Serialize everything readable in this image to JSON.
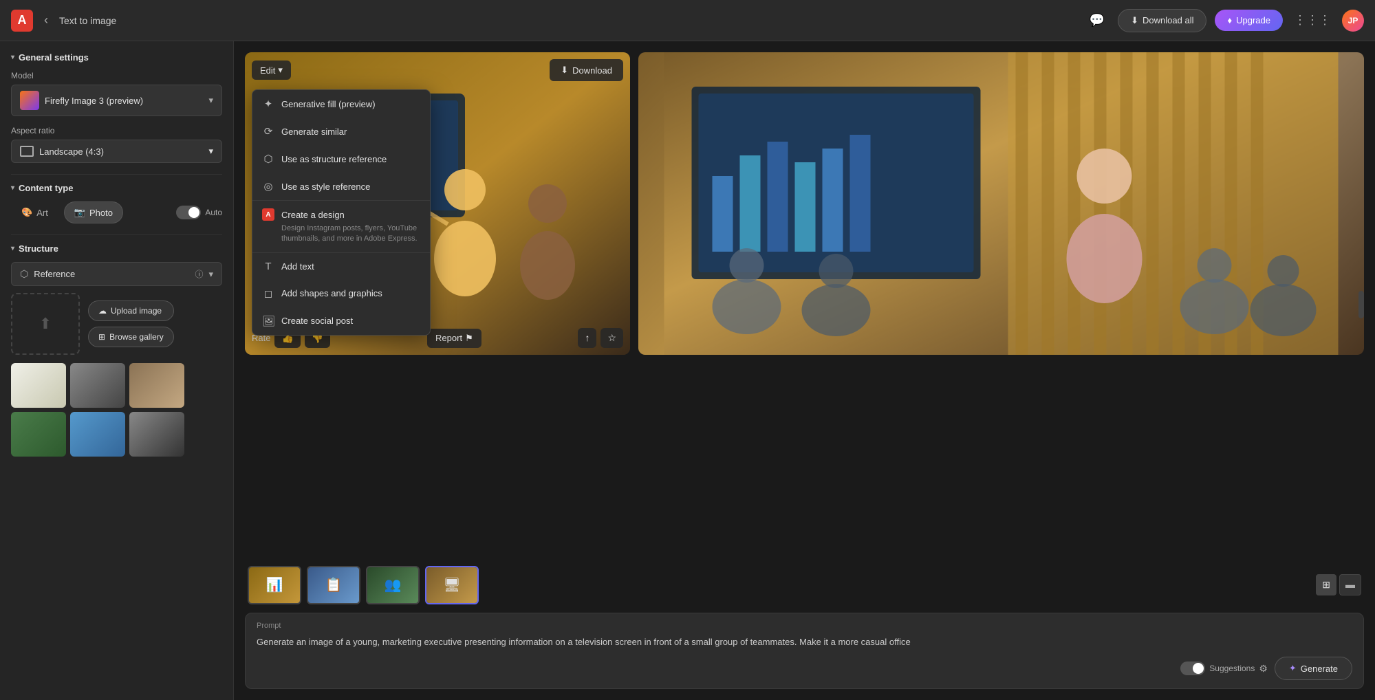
{
  "topbar": {
    "logo": "A",
    "back_icon": "‹",
    "title": "Text to image",
    "chat_icon": "💬",
    "download_all_label": "Download all",
    "upgrade_label": "Upgrade",
    "grid_icon": "⋮⋮⋮",
    "avatar": "JP"
  },
  "sidebar": {
    "general_settings_label": "General settings",
    "model_label": "Model",
    "model_name": "Firefly Image 3 (preview)",
    "aspect_label": "Aspect ratio",
    "aspect_name": "Landscape (4:3)",
    "content_type_label": "Content type",
    "type_art": "Art",
    "type_photo": "Photo",
    "auto_label": "Auto",
    "structure_label": "Structure",
    "reference_label": "Reference",
    "upload_image_label": "Upload image",
    "browse_gallery_label": "Browse gallery"
  },
  "dropdown": {
    "items": [
      {
        "icon": "✦",
        "label": "Generative fill (preview)"
      },
      {
        "icon": "⟳",
        "label": "Generate similar"
      },
      {
        "icon": "⬡",
        "label": "Use as structure reference"
      },
      {
        "icon": "◎",
        "label": "Use as style reference"
      }
    ],
    "create_design_title": "Create a design",
    "create_design_desc": "Design Instagram posts, flyers, YouTube thumbnails, and more in Adobe Express.",
    "items2": [
      {
        "icon": "T",
        "label": "Add text"
      },
      {
        "icon": "◻",
        "label": "Add shapes and graphics"
      },
      {
        "icon": "🖼",
        "label": "Create social post"
      }
    ]
  },
  "image_left": {
    "edit_label": "Edit",
    "download_label": "Download",
    "rate_label": "Rate",
    "report_label": "Report",
    "share_icon": "↑",
    "star_icon": "☆"
  },
  "thumbnails": [
    {
      "id": "t1"
    },
    {
      "id": "t2"
    },
    {
      "id": "t3"
    },
    {
      "id": "t4",
      "active": true
    }
  ],
  "prompt": {
    "label": "Prompt",
    "text": "Generate an image of a young, marketing executive presenting information on a television screen in front of a small group of teammates. Make it a more casual office",
    "suggestions_label": "Suggestions",
    "generate_label": "Generate"
  }
}
